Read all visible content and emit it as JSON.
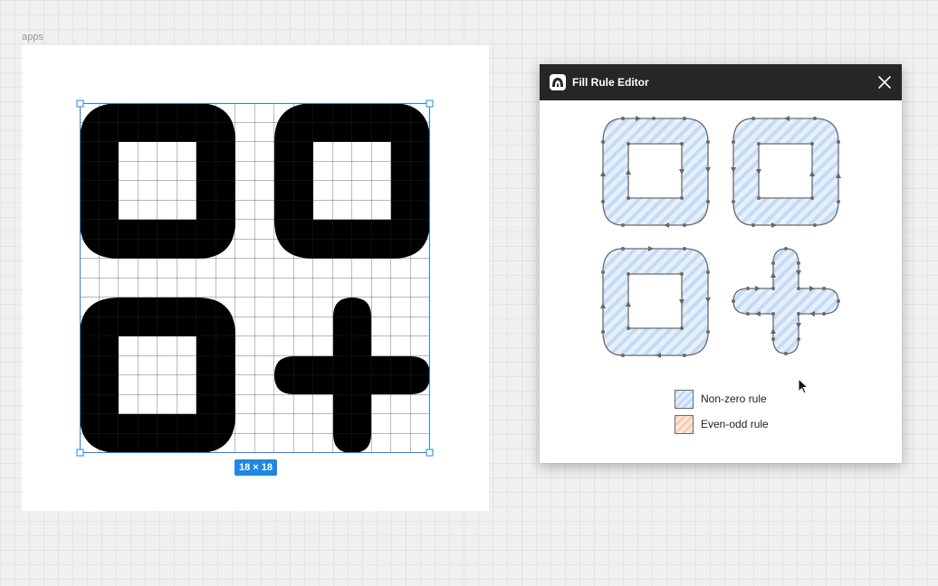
{
  "canvas": {
    "frame_label": "apps",
    "selection_size": "18 × 18",
    "icon_fill": "#000000",
    "selection_color": "#1e88e5"
  },
  "dialog": {
    "title": "Fill Rule Editor",
    "app_icon": "fill-rule-app-icon",
    "close_icon": "close-icon",
    "legend": [
      {
        "label": "Non-zero rule",
        "color": "#cfe2f7"
      },
      {
        "label": "Even-odd rule",
        "color": "#f9ddc8"
      }
    ]
  }
}
